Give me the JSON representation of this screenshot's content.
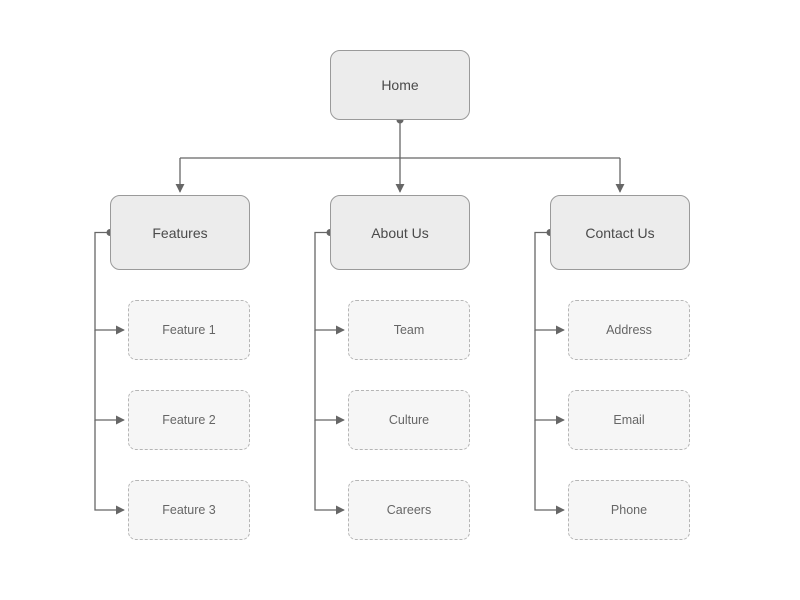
{
  "diagram": {
    "root": {
      "label": "Home"
    },
    "sections": [
      {
        "label": "Features",
        "children": [
          {
            "label": "Feature 1"
          },
          {
            "label": "Feature 2"
          },
          {
            "label": "Feature 3"
          }
        ]
      },
      {
        "label": "About Us",
        "children": [
          {
            "label": "Team"
          },
          {
            "label": "Culture"
          },
          {
            "label": "Careers"
          }
        ]
      },
      {
        "label": "Contact Us",
        "children": [
          {
            "label": "Address"
          },
          {
            "label": "Email"
          },
          {
            "label": "Phone"
          }
        ]
      }
    ]
  },
  "colors": {
    "node_fill": "#ececec",
    "node_border": "#9a9a9a",
    "leaf_fill": "#f6f6f6",
    "leaf_border": "#b5b5b5",
    "connector": "#666666"
  }
}
